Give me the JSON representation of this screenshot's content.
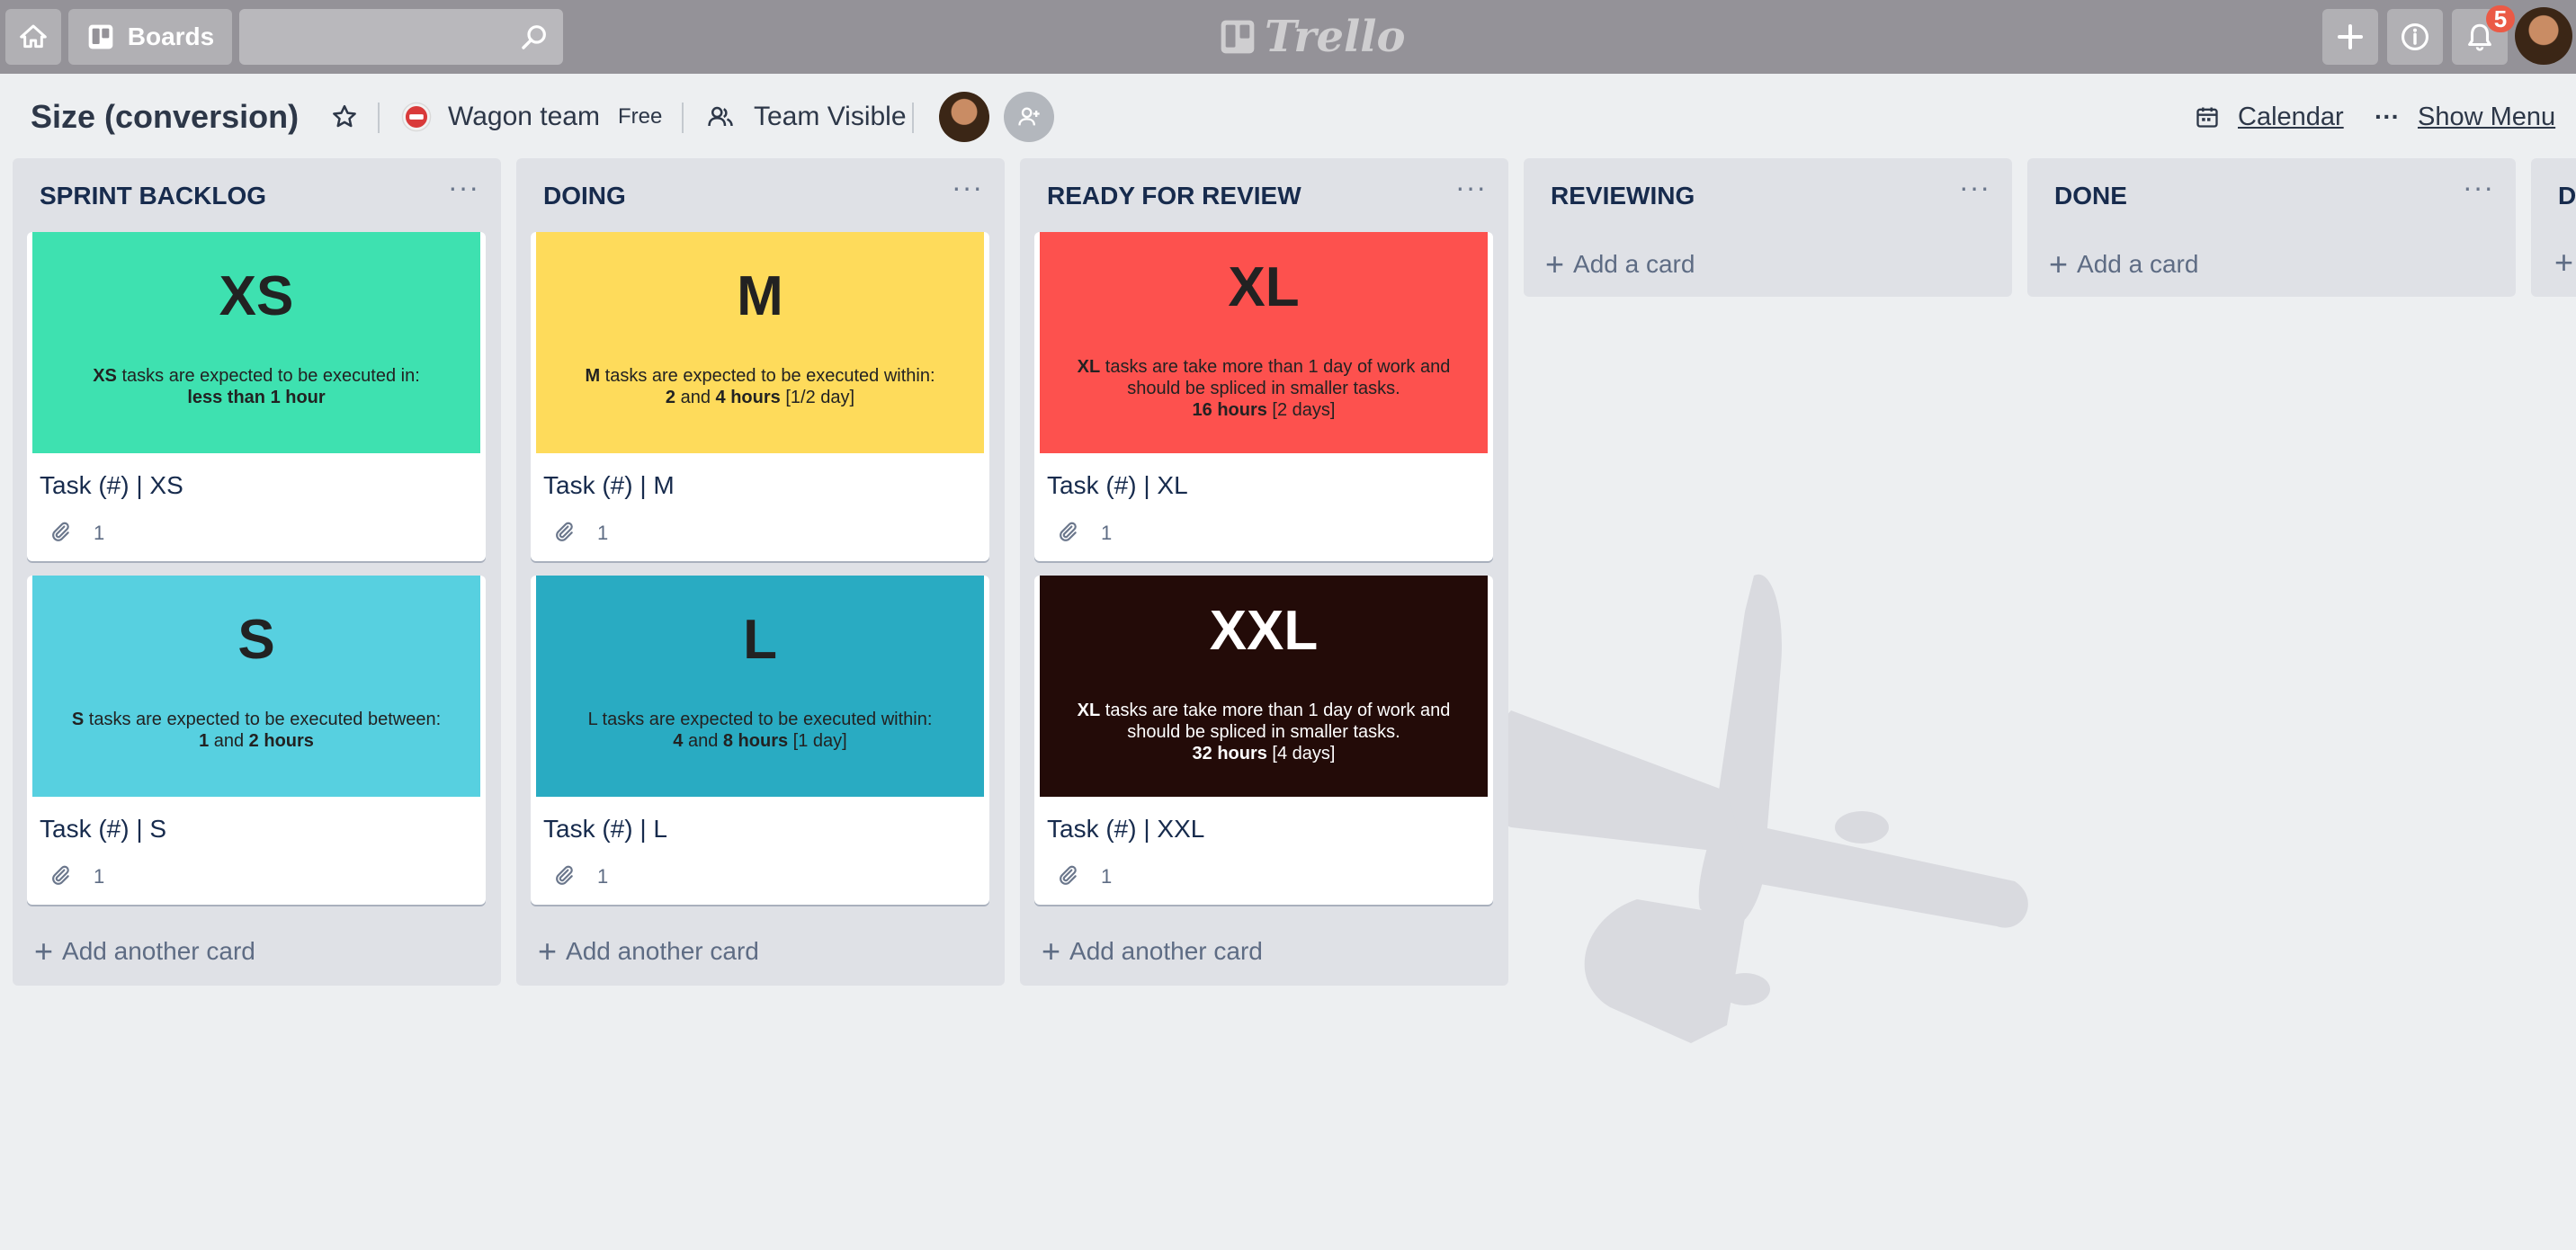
{
  "topbar": {
    "boards_label": "Boards",
    "logo_text": "Trello",
    "notification_count": "5"
  },
  "board": {
    "title": "Size (conversion)",
    "team": "Wagon team",
    "team_plan": "Free",
    "visibility": "Team Visible",
    "calendar_label": "Calendar",
    "show_menu_label": "Show Menu",
    "more_glyph": "···"
  },
  "lists": [
    {
      "title": "SPRINT BACKLOG",
      "add_label": "Add another card",
      "cards": [
        {
          "cover_color": "#3ee1b0",
          "cover_text_color": "#222222",
          "cover_title": "XS",
          "cover_lines": [
            [
              "XS",
              " tasks are expected to be executed in:"
            ],
            [
              "less than 1 hour"
            ]
          ],
          "title": "Task (#) | XS",
          "attachments": "1"
        },
        {
          "cover_color": "#57d0e0",
          "cover_text_color": "#222222",
          "cover_title": "S",
          "cover_lines": [
            [
              "S",
              " tasks are expected to be executed between:"
            ],
            [
              "1",
              " and ",
              "2 hours"
            ]
          ],
          "title": "Task (#) | S",
          "attachments": "1"
        }
      ]
    },
    {
      "title": "DOING",
      "add_label": "Add another card",
      "cards": [
        {
          "cover_color": "#fedb5b",
          "cover_text_color": "#222222",
          "cover_title": "M",
          "cover_lines": [
            [
              "M",
              " tasks are expected to be executed within:"
            ],
            [
              "2",
              " and ",
              "4 hours",
              " [1/2 day]"
            ]
          ],
          "title": "Task (#) | M",
          "attachments": "1"
        },
        {
          "cover_color": "#29abc2",
          "cover_text_color": "#222222",
          "cover_title": "L",
          "cover_lines": [
            [
              "",
              "L tasks are expected to be executed within:"
            ],
            [
              "4",
              " and ",
              "8 hours",
              " [1 day]"
            ]
          ],
          "title": "Task (#) | L",
          "attachments": "1"
        }
      ]
    },
    {
      "title": "READY FOR REVIEW",
      "add_label": "Add another card",
      "cards": [
        {
          "cover_color": "#fd514e",
          "cover_text_color": "#222222",
          "cover_title": "XL",
          "cover_lines": [
            [
              "XL",
              " tasks are take more than 1 day of work and"
            ],
            [
              "",
              "should be spliced in smaller tasks."
            ],
            [
              "16 hours",
              " [2 days]"
            ]
          ],
          "title": "Task (#) | XL",
          "attachments": "1"
        },
        {
          "cover_color": "#230b08",
          "cover_text_color": "#ffffff",
          "cover_title": "XXL",
          "cover_lines": [
            [
              "XL",
              " tasks are take more than 1 day of work and"
            ],
            [
              "",
              "should be spliced in smaller tasks."
            ],
            [
              "32 hours",
              " [4 days]"
            ]
          ],
          "title": "Task (#) | XXL",
          "attachments": "1"
        }
      ]
    },
    {
      "title": "REVIEWING",
      "add_label": "Add a card",
      "cards": []
    },
    {
      "title": "DONE",
      "add_label": "Add a card",
      "cards": []
    },
    {
      "title": "D",
      "add_label": "",
      "cards": []
    }
  ],
  "icons": [
    "home-icon",
    "boards-icon",
    "search-icon",
    "plus-icon",
    "info-icon",
    "bell-icon",
    "star-icon",
    "team-icon",
    "visibility-icon",
    "calendar-icon",
    "add-member-icon",
    "paperclip-icon",
    "airplane-background"
  ]
}
